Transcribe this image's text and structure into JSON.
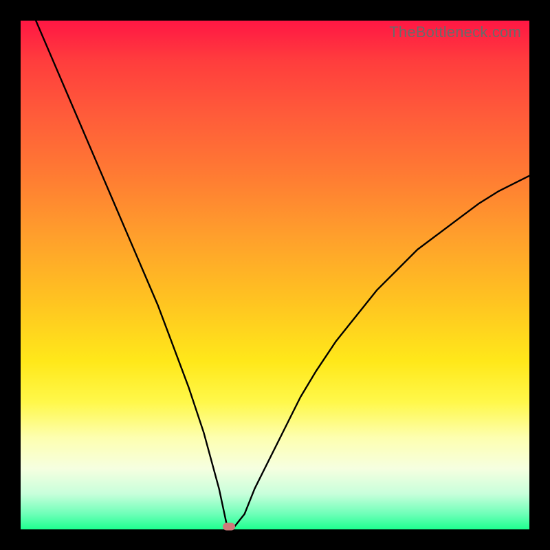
{
  "watermark": "TheBottleneck.com",
  "chart_data": {
    "type": "line",
    "title": "",
    "xlabel": "",
    "ylabel": "",
    "xlim": [
      0,
      100
    ],
    "ylim": [
      0,
      100
    ],
    "x": [
      3,
      6,
      9,
      12,
      15,
      18,
      21,
      24,
      27,
      30,
      33,
      36,
      39,
      40.5,
      42,
      44,
      46,
      49,
      52,
      55,
      58,
      62,
      66,
      70,
      74,
      78,
      82,
      86,
      90,
      94,
      98,
      100
    ],
    "values": [
      100,
      93,
      86,
      79,
      72,
      65,
      58,
      51,
      44,
      36,
      28,
      19,
      8,
      1,
      0.5,
      3,
      8,
      14,
      20,
      26,
      31,
      37,
      42,
      47,
      51,
      55,
      58,
      61,
      64,
      66.5,
      68.5,
      69.5
    ],
    "marker": {
      "x": 41,
      "y": 0.5
    }
  },
  "gradient_colors": {
    "top": "#ff1744",
    "mid": "#ffe81a",
    "bottom": "#1eff8f"
  }
}
